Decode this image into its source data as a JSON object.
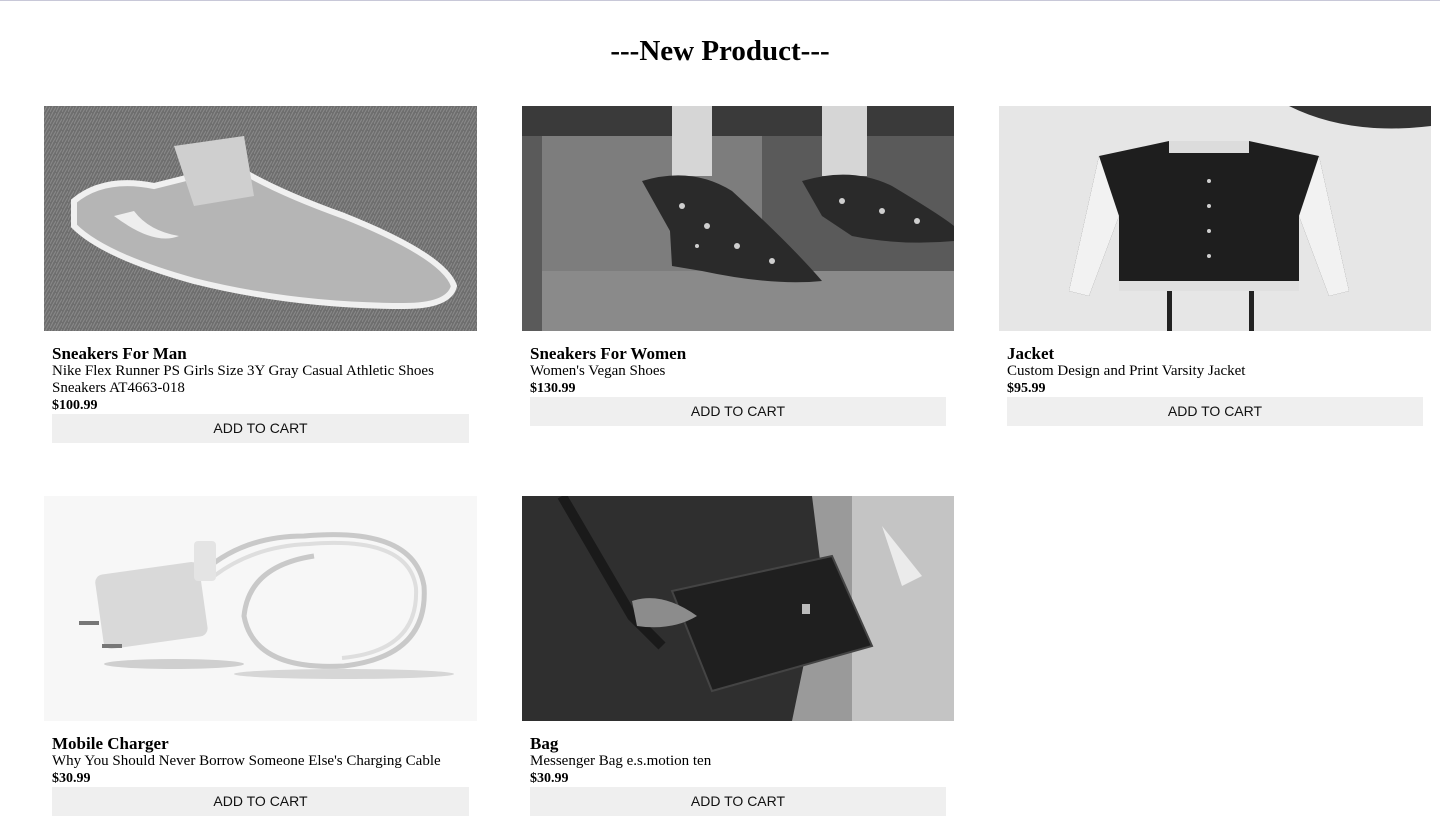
{
  "page": {
    "title": "---New Product---"
  },
  "products": [
    {
      "name": "Sneakers For Man",
      "description": "Nike Flex Runner PS Girls Size 3Y Gray Casual Athletic Shoes Sneakers AT4663-018",
      "price": "$100.99",
      "button": "ADD TO CART",
      "image": "sneaker-photo"
    },
    {
      "name": "Sneakers For Women",
      "description": "Women's Vegan Shoes",
      "price": "$130.99",
      "button": "ADD TO CART",
      "image": "floral-shoes-photo"
    },
    {
      "name": "Jacket",
      "description": "Custom Design and Print Varsity Jacket",
      "price": "$95.99",
      "button": "ADD TO CART",
      "image": "varsity-jacket-photo"
    },
    {
      "name": "Mobile Charger",
      "description": "Why You Should Never Borrow Someone Else's Charging Cable",
      "price": "$30.99",
      "button": "ADD TO CART",
      "image": "charger-photo"
    },
    {
      "name": "Bag",
      "description": "Messenger Bag e.s.motion ten",
      "price": "$30.99",
      "button": "ADD TO CART",
      "image": "messenger-bag-photo"
    }
  ]
}
